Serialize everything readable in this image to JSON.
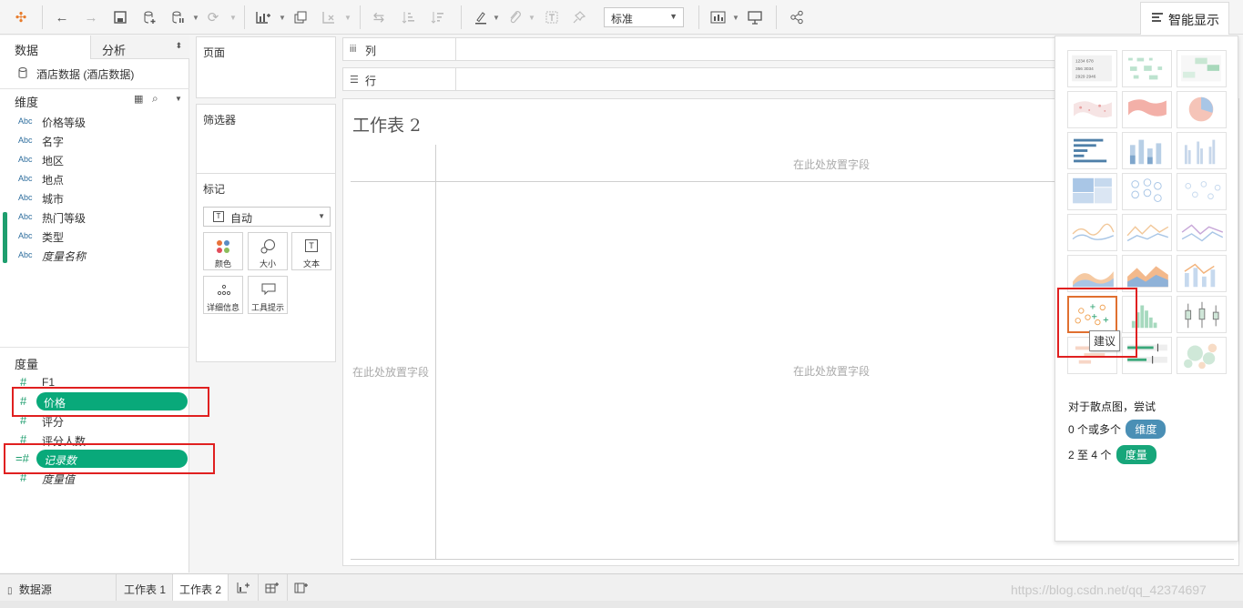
{
  "toolbar": {
    "view_mode": "标准",
    "show_me_label": "智能显示",
    "icons": [
      "tableau-logo-icon",
      "undo-icon",
      "redo-icon",
      "save-icon",
      "new-datasource-icon",
      "pause-update-icon",
      "refresh-icon",
      "new-worksheet-icon",
      "duplicate-icon",
      "clear-icon",
      "swap-icon",
      "sort-asc-icon",
      "sort-desc-icon",
      "highlight-icon",
      "group-icon",
      "label-icon",
      "pin-icon",
      "show-cards-icon",
      "presentation-icon",
      "share-icon"
    ]
  },
  "data_pane": {
    "tab_data": "数据",
    "tab_analysis": "分析",
    "datasource": "酒店数据 (酒店数据)",
    "dimensions_header": "维度",
    "dimensions": [
      {
        "type": "Abc",
        "name": "价格等级",
        "italic": false
      },
      {
        "type": "Abc",
        "name": "名字",
        "italic": false
      },
      {
        "type": "Abc",
        "name": "地区",
        "italic": false
      },
      {
        "type": "Abc",
        "name": "地点",
        "italic": false
      },
      {
        "type": "Abc",
        "name": "城市",
        "italic": false
      },
      {
        "type": "Abc",
        "name": "热门等级",
        "italic": false
      },
      {
        "type": "Abc",
        "name": "类型",
        "italic": false
      },
      {
        "type": "Abc",
        "name": "度量名称",
        "italic": true
      }
    ],
    "measures_header": "度量",
    "measures": [
      {
        "type": "#",
        "name": "F1",
        "italic": false,
        "selected": false
      },
      {
        "type": "#",
        "name": "价格",
        "italic": false,
        "selected": true
      },
      {
        "type": "#",
        "name": "评分",
        "italic": false,
        "selected": false
      },
      {
        "type": "#",
        "name": "评分人数",
        "italic": false,
        "selected": false
      },
      {
        "type": "=#",
        "name": "记录数",
        "italic": true,
        "selected": true
      },
      {
        "type": "#",
        "name": "度量值",
        "italic": true,
        "selected": false
      }
    ]
  },
  "cards": {
    "pages": "页面",
    "filters": "筛选器",
    "marks": "标记",
    "mark_type": "自动",
    "mark_buttons": [
      "颜色",
      "大小",
      "文本",
      "详细信息",
      "工具提示"
    ]
  },
  "shelves": {
    "columns": "列",
    "rows": "行"
  },
  "worksheet": {
    "title": "工作表 2",
    "drop_hint_top": "在此处放置字段",
    "drop_hint_left": "在此处放置字段",
    "drop_hint_center": "在此处放置字段"
  },
  "show_me": {
    "tooltip": "建议",
    "hint_title": "对于散点图，尝试",
    "req1_prefix": "0 个或多个",
    "req1_badge": "维度",
    "req2_prefix": "2 至 4 个",
    "req2_badge": "度量",
    "selected_chart": "scatter-plot"
  },
  "bottom_tabs": {
    "datasource": "数据源",
    "sheet1": "工作表 1",
    "sheet2": "工作表 2"
  },
  "watermark": "https://blog.csdn.net/qq_42374697",
  "colors": {
    "measure_pill": "#09a97a",
    "dimension_badge": "#4a8fb5",
    "measure_badge": "#17a67a",
    "highlight": "#e02020"
  }
}
